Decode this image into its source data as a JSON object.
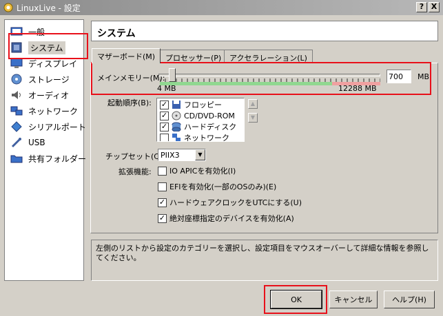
{
  "window": {
    "title": "LinuxLive - 設定",
    "help_btn": "?",
    "close_btn": "X"
  },
  "sidebar": {
    "items": [
      {
        "label": "一般",
        "icon": "general-icon"
      },
      {
        "label": "システム",
        "icon": "system-icon"
      },
      {
        "label": "ディスプレイ",
        "icon": "display-icon"
      },
      {
        "label": "ストレージ",
        "icon": "storage-icon"
      },
      {
        "label": "オーディオ",
        "icon": "audio-icon"
      },
      {
        "label": "ネットワーク",
        "icon": "network-icon"
      },
      {
        "label": "シリアルポート",
        "icon": "serial-port-icon"
      },
      {
        "label": "USB",
        "icon": "usb-icon"
      },
      {
        "label": "共有フォルダー",
        "icon": "shared-folder-icon"
      }
    ],
    "selected": "システム"
  },
  "main": {
    "title": "システム",
    "tabs": [
      {
        "label": "マザーボード(M)"
      },
      {
        "label": "プロセッサー(P)"
      },
      {
        "label": "アクセラレーション(L)"
      }
    ],
    "memory": {
      "label": "メインメモリー(M):",
      "value": "700",
      "unit": "MB",
      "min_label": "4 MB",
      "max_label": "12288 MB",
      "level_fraction": 0.057
    },
    "boot": {
      "label": "起動順序(B):",
      "items": [
        {
          "label": "フロッピー",
          "checked": true
        },
        {
          "label": "CD/DVD-ROM",
          "checked": true
        },
        {
          "label": "ハードディスク",
          "checked": true
        },
        {
          "label": "ネットワーク",
          "checked": false
        }
      ]
    },
    "chipset": {
      "label": "チップセット(C):",
      "value": "PIIX3"
    },
    "features": {
      "label": "拡張機能:",
      "items": [
        {
          "label": "IO APICを有効化(I)",
          "checked": false
        },
        {
          "label": "EFIを有効化(一部のOSのみ)(E)",
          "checked": false
        },
        {
          "label": "ハードウェアクロックをUTCにする(U)",
          "checked": true
        },
        {
          "label": "絶対座標指定のデバイスを有効化(A)",
          "checked": true
        }
      ]
    }
  },
  "info": {
    "text": "左側のリストから設定のカテゴリーを選択し、設定項目をマウスオーバーして詳細な情報を参照してください。"
  },
  "buttons": {
    "ok": "OK",
    "cancel": "キャンセル",
    "help": "ヘルプ(H)"
  },
  "colors": {
    "highlight_red": "#e8101a",
    "slider_green": "#90d890",
    "slider_red": "#f0a0a0"
  }
}
